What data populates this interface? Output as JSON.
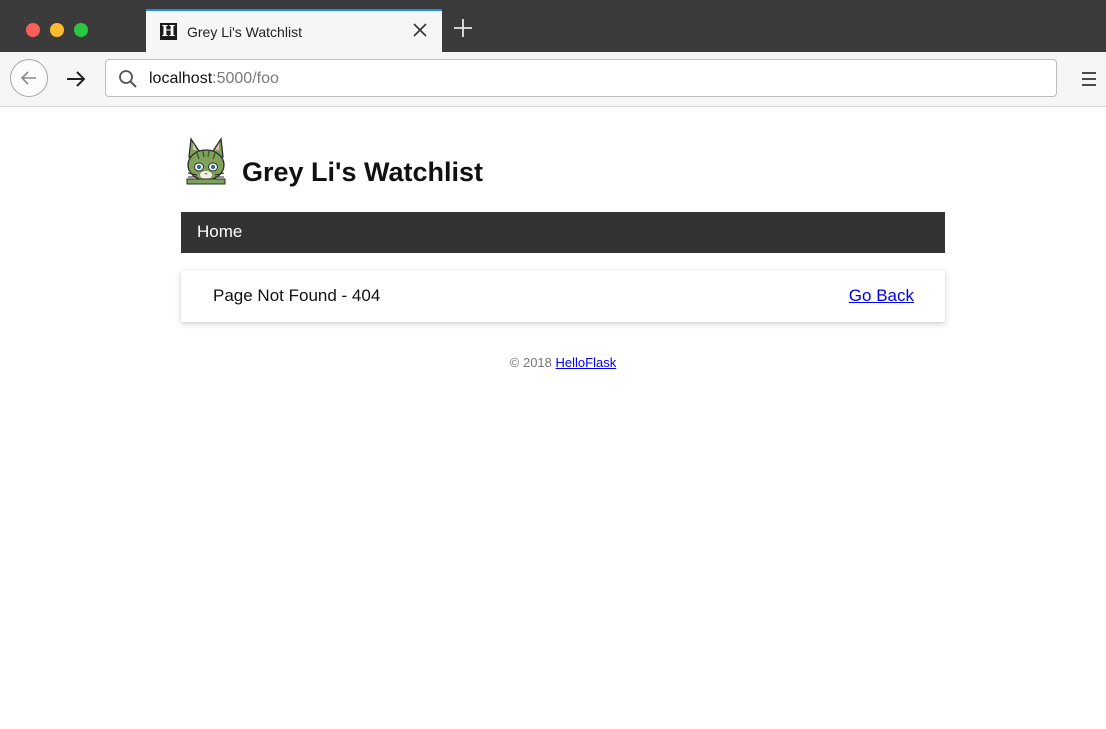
{
  "browser": {
    "tab_title": "Grey Li's Watchlist",
    "tab_favicon": "H",
    "url_host": "localhost",
    "url_path": ":5000/foo",
    "accent_color": "#1f8df0"
  },
  "page": {
    "site_title": "Grey Li's Watchlist",
    "nav": {
      "home_label": "Home"
    },
    "error": {
      "message": "Page Not Found - 404",
      "back_label": "Go Back"
    },
    "footer": {
      "copyright": "© 2018",
      "link_label": "HelloFlask"
    }
  },
  "icons": {
    "back": "arrow-left-icon",
    "forward": "arrow-right-icon",
    "search": "search-icon",
    "close_tab": "close-icon",
    "new_tab": "plus-icon",
    "menu": "hamburger-menu-icon",
    "avatar": "cat-avatar-icon"
  }
}
